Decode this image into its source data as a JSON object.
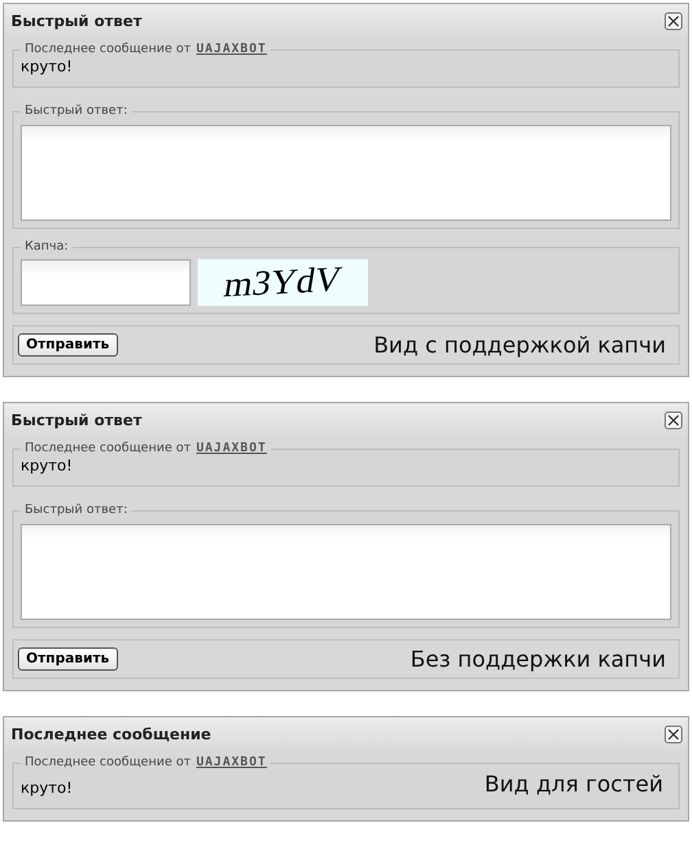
{
  "panels": [
    {
      "title": "Быстрый ответ",
      "last_message": {
        "legend": "Последнее сообщение от",
        "author": "UAJAXBOT",
        "text": "круто!"
      },
      "reply": {
        "legend": "Быстрый ответ:"
      },
      "captcha": {
        "legend": "Капча:",
        "image_text": "m3YdV"
      },
      "footer": {
        "button": "Отправить",
        "caption": "Вид с поддержкой капчи"
      }
    },
    {
      "title": "Быстрый ответ",
      "last_message": {
        "legend": "Последнее сообщение от",
        "author": "UAJAXBOT",
        "text": "круто!"
      },
      "reply": {
        "legend": "Быстрый ответ:"
      },
      "footer": {
        "button": "Отправить",
        "caption": "Без поддержки капчи"
      }
    },
    {
      "title": "Последнее сообщение",
      "last_message": {
        "legend": "Последнее сообщение от",
        "author": "UAJAXBOT",
        "text": "круто!",
        "caption": "Вид для гостей"
      }
    }
  ]
}
